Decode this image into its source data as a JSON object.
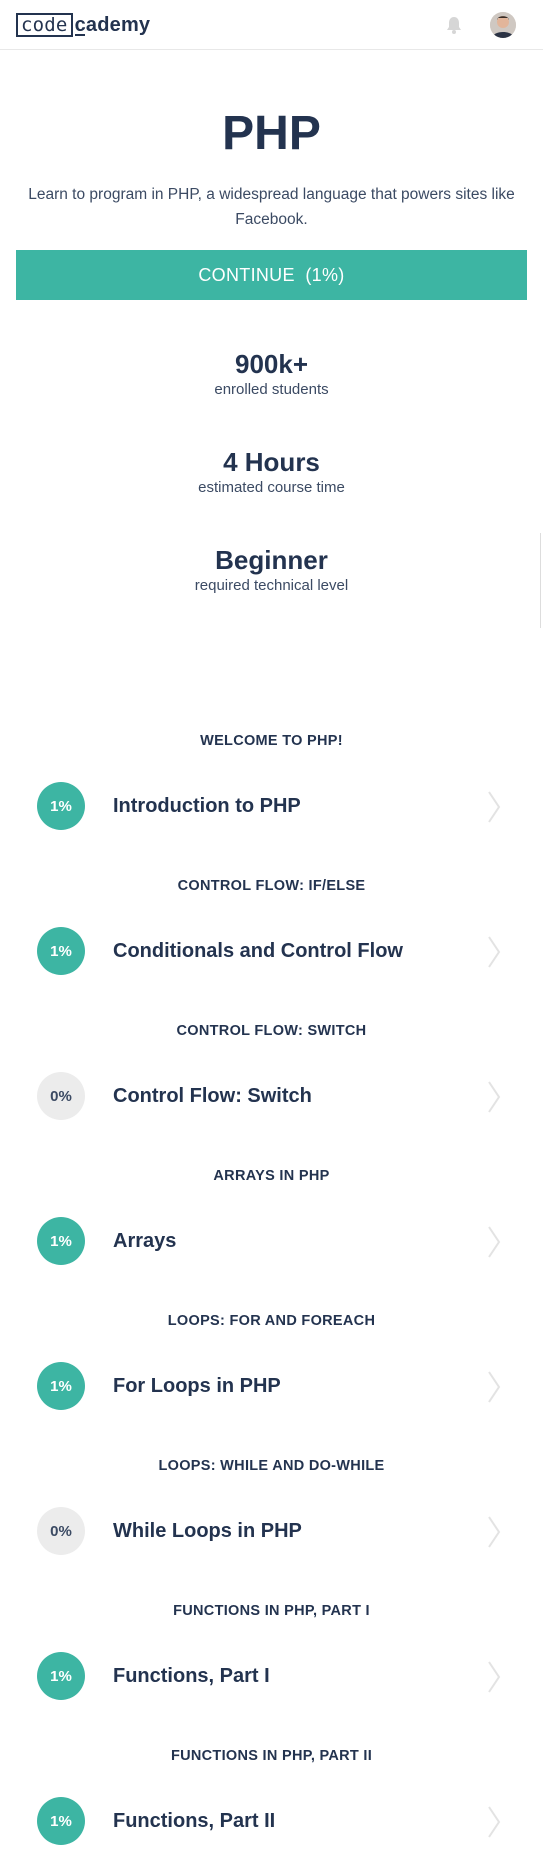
{
  "header": {
    "logo_box_text": "code",
    "logo_rest_text": "cademy",
    "icons": [
      "bell-icon",
      "avatar"
    ]
  },
  "course": {
    "title": "PHP",
    "description": "Learn to program in PHP, a widespread language that powers sites like Facebook.",
    "continue_label": "CONTINUE",
    "progress_label": "(1%)"
  },
  "stats": [
    {
      "value": "900k+",
      "label": "enrolled students"
    },
    {
      "value": "4 Hours",
      "label": "estimated course time"
    },
    {
      "value": "Beginner",
      "label": "required technical level"
    }
  ],
  "units": [
    {
      "heading": "WELCOME TO PHP!",
      "lesson": "Introduction to PHP",
      "progress": "1%"
    },
    {
      "heading": "CONTROL FLOW: IF/ELSE",
      "lesson": "Conditionals and Control Flow",
      "progress": "1%"
    },
    {
      "heading": "CONTROL FLOW: SWITCH",
      "lesson": "Control Flow: Switch",
      "progress": "0%"
    },
    {
      "heading": "ARRAYS IN PHP",
      "lesson": "Arrays",
      "progress": "1%"
    },
    {
      "heading": "LOOPS: FOR AND FOREACH",
      "lesson": "For Loops in PHP",
      "progress": "1%"
    },
    {
      "heading": "LOOPS: WHILE AND DO-WHILE",
      "lesson": "While Loops in PHP",
      "progress": "0%"
    },
    {
      "heading": "FUNCTIONS IN PHP, PART I",
      "lesson": "Functions, Part I",
      "progress": "1%"
    },
    {
      "heading": "FUNCTIONS IN PHP, PART II",
      "lesson": "Functions, Part II",
      "progress": "1%"
    }
  ],
  "colors": {
    "accent": "#3db5a3",
    "navy": "#23334f",
    "badge_empty": "#ececec"
  }
}
